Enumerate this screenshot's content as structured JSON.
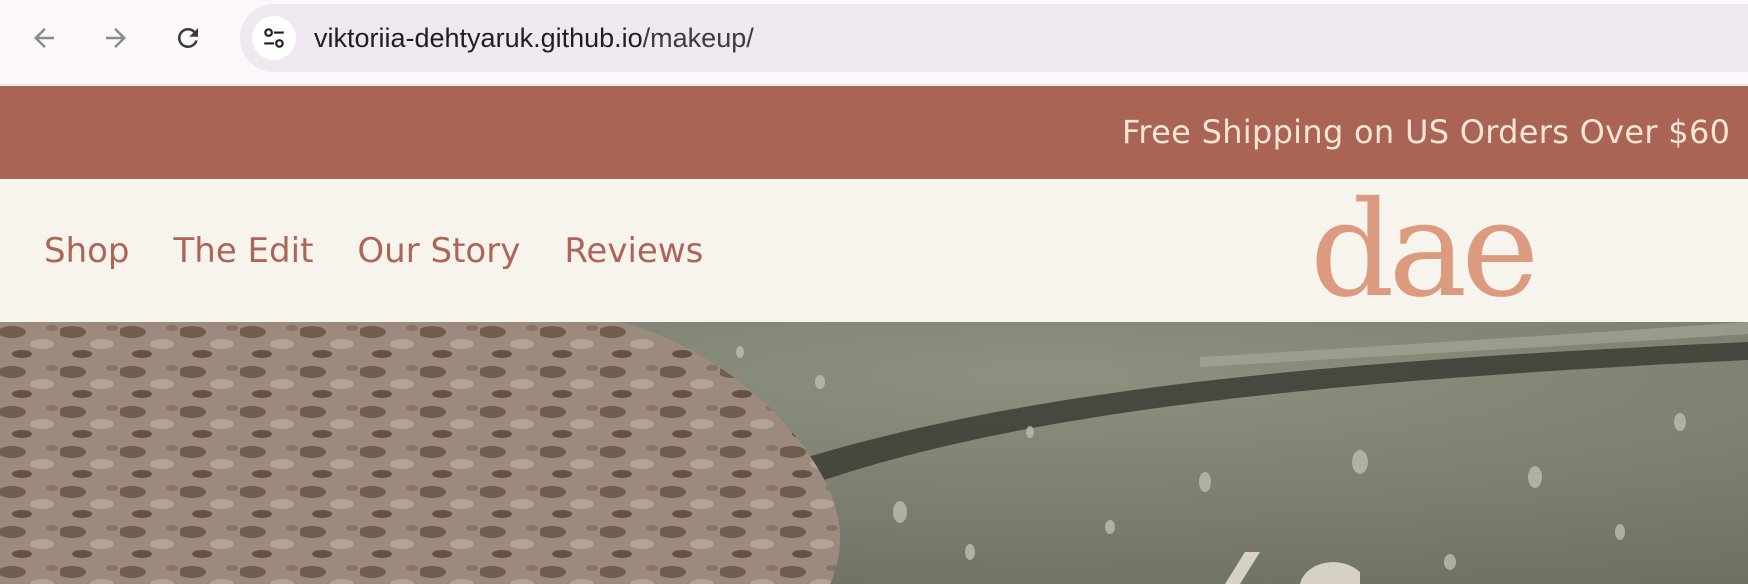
{
  "browser": {
    "url_host": "viktoriia-dehtyaruk.github.io",
    "url_path": "/makeup/",
    "icons": {
      "back": "arrow-left-icon",
      "forward": "arrow-right-icon",
      "reload": "reload-icon",
      "site_info": "tune-icon"
    }
  },
  "announcement": {
    "text": "Free Shipping on US Orders Over $60"
  },
  "header": {
    "nav": [
      {
        "label": "Shop"
      },
      {
        "label": "The Edit"
      },
      {
        "label": "Our Story"
      },
      {
        "label": "Reviews"
      }
    ],
    "logo_text": "dae"
  },
  "hero": {
    "image": "hero-product-photo"
  },
  "colors": {
    "announcement_bg": "#a96455",
    "announcement_text": "#f6e4d6",
    "nav_text": "#ad6556",
    "logo": "#dc9b7e",
    "header_bg": "#f7f4ee"
  }
}
